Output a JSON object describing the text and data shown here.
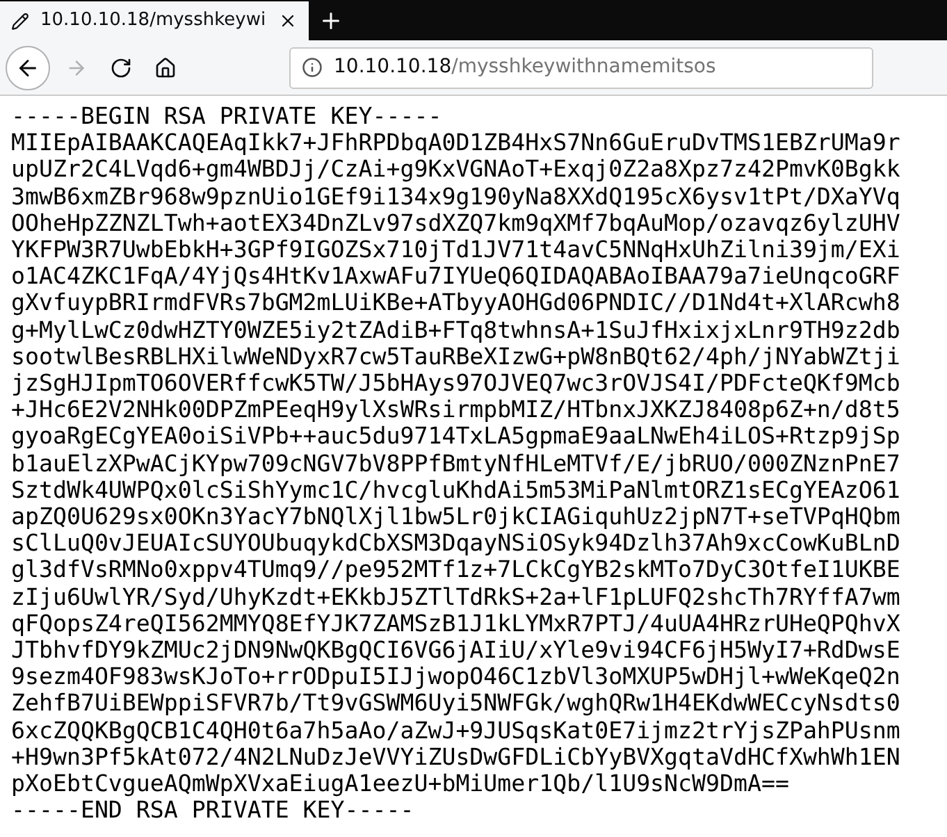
{
  "tabs": [
    {
      "title": "10.10.10.18/mysshkeywi",
      "selected": true
    }
  ],
  "nav": [
    {
      "kind": "back",
      "disabled": false
    },
    {
      "kind": "forward",
      "disabled": true
    },
    {
      "kind": "reload",
      "disabled": false
    },
    {
      "kind": "home",
      "disabled": false
    }
  ],
  "address_bar": {
    "host": "10.10.10.18",
    "path": "/mysshkeywithnamemitsos"
  },
  "page_lines": [
    "-----BEGIN RSA PRIVATE KEY-----",
    "MIIEpAIBAAKCAQEAqIkk7+JFhRPDbqA0D1ZB4HxS7Nn6GuEruDvTMS1EBZrUMa9r",
    "upUZr2C4LVqd6+gm4WBDJj/CzAi+g9KxVGNAoT+Exqj0Z2a8Xpz7z42PmvK0Bgkk",
    "3mwB6xmZBr968w9pznUio1GEf9i134x9g190yNa8XXdQ195cX6ysv1tPt/DXaYVq",
    "OOheHpZZNZLTwh+aotEX34DnZLv97sdXZQ7km9qXMf7bqAuMop/ozavqz6ylzUHV",
    "YKFPW3R7UwbEbkH+3GPf9IGOZSx710jTd1JV71t4avC5NNqHxUhZilni39jm/EXi",
    "o1AC4ZKC1FqA/4YjQs4HtKv1AxwAFu7IYUeQ6QIDAQABAoIBAA79a7ieUnqcoGRF",
    "gXvfuypBRIrmdFVRs7bGM2mLUiKBe+ATbyyAOHGd06PNDIC//D1Nd4t+XlARcwh8",
    "g+MylLwCz0dwHZTY0WZE5iy2tZAdiB+FTq8twhnsA+1SuJfHxixjxLnr9TH9z2db",
    "sootwlBesRBLHXilwWeNDyxR7cw5TauRBeXIzwG+pW8nBQt62/4ph/jNYabWZtji",
    "jzSgHJIpmTO6OVERffcwK5TW/J5bHAys97OJVEQ7wc3rOVJS4I/PDFcteQKf9Mcb",
    "+JHc6E2V2NHk00DPZmPEeqH9ylXsWRsirmpbMIZ/HTbnxJXKZJ8408p6Z+n/d8t5",
    "gyoaRgECgYEA0oiSiVPb++auc5du9714TxLA5gpmaE9aaLNwEh4iLOS+Rtzp9jSp",
    "b1auElzXPwACjKYpw709cNGV7bV8PPfBmtyNfHLeMTVf/E/jbRUO/000ZNznPnE7",
    "SztdWk4UWPQx0lcSiShYymc1C/hvcgluKhdAi5m53MiPaNlmtORZ1sECgYEAzO61",
    "apZQ0U629sx0OKn3YacY7bNQlXjl1bw5Lr0jkCIAGiquhUz2jpN7T+seTVPqHQbm",
    "sClLuQ0vJEUAIcSUYOUbuqykdCbXSM3DqayNSiOSyk94Dzlh37Ah9xcCowKuBLnD",
    "gl3dfVsRMNo0xppv4TUmq9//pe952MTf1z+7LCkCgYB2skMTo7DyC3OtfeI1UKBE",
    "zIju6UwlYR/Syd/UhyKzdt+EKkbJ5ZTlTdRkS+2a+lF1pLUFQ2shcTh7RYffA7wm",
    "qFQopsZ4reQI562MMYQ8EfYJK7ZAMSzB1J1kLYMxR7PTJ/4uUA4HRzrUHeQPQhvX",
    "JTbhvfDY9kZMUc2jDN9NwQKBgQCI6VG6jAIiU/xYle9vi94CF6jH5WyI7+RdDwsE",
    "9sezm4OF983wsKJoTo+rrODpuI5IJjwopO46C1zbVl3oMXUP5wDHjl+wWeKqeQ2n",
    "ZehfB7UiBEWppiSFVR7b/Tt9vGSWM6Uyi5NWFGk/wghQRw1H4EKdwWECcyNsdts0",
    "6xcZQQKBgQCB1C4QH0t6a7h5aAo/aZwJ+9JUSqsKat0E7ijmz2trYjsZPahPUsnm",
    "+H9wn3Pf5kAt072/4N2LNuDzJeVVYiZUsDwGFDLiCbYyBVXgqtaVdHCfXwhWh1EN",
    "pXoEbtCvgueAQmWpXVxaEiugA1eezU+bMiUmer1Qb/l1U9sNcW9DmA==",
    "-----END RSA PRIVATE KEY-----"
  ]
}
